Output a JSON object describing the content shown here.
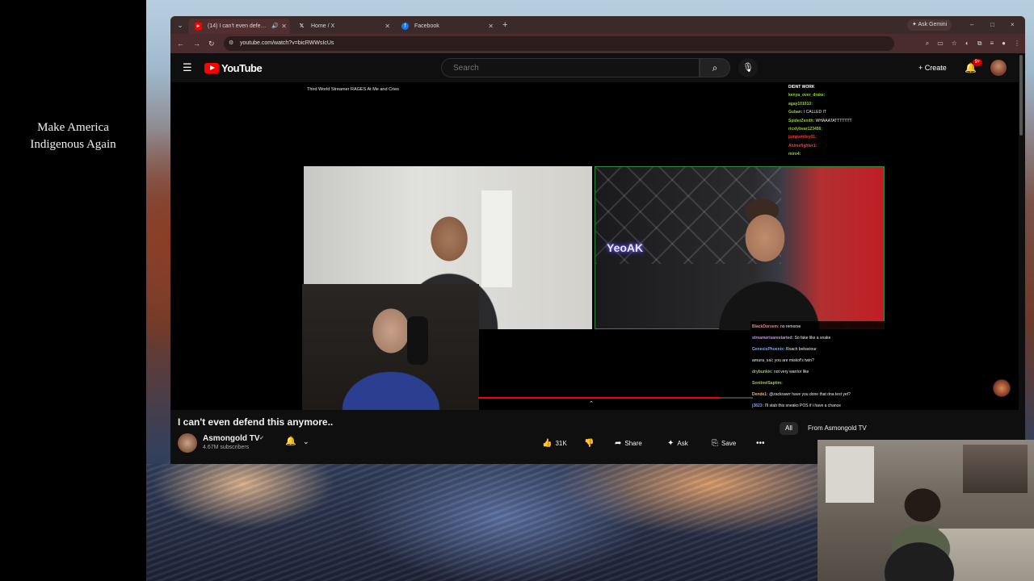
{
  "overlay": {
    "slogan_line1": "Make America",
    "slogan_line2": "Indigenous Again"
  },
  "browser": {
    "tabs": [
      {
        "label": "(14) I can't even defend thi",
        "active": true,
        "favicon": "youtube-icon"
      },
      {
        "label": "Home / X",
        "active": false,
        "favicon": "x-icon"
      },
      {
        "label": "Facebook",
        "active": false,
        "favicon": "facebook-icon"
      }
    ],
    "new_tab": "+",
    "ask_gemini": "Ask Gemini",
    "url": "youtube.com/watch?v=bicRWWsIcUs",
    "window_controls": [
      "–",
      "□",
      "×"
    ]
  },
  "youtube": {
    "logo_text": "YouTube",
    "search_placeholder": "Search",
    "create_label": "Create",
    "notification_count": "9+",
    "brand_color": "#ff0000"
  },
  "video": {
    "stream_title": "Third World Streamer RAGES At Me and Cries",
    "neon_sign": "YeoAK",
    "progress_fraction": 0.88,
    "chat_top": [
      {
        "user": "DIDNT WORK",
        "msg": "",
        "color": "#ffffff"
      },
      {
        "user": "kenya_over_drake:",
        "msg": "",
        "color": "#9acd32"
      },
      {
        "user": "agay101010:",
        "msg": "",
        "color": "#9acd32"
      },
      {
        "user": "Guban:",
        "msg": "I CALLED IT",
        "color": "#9acd32"
      },
      {
        "user": "SpiderZenith:",
        "msg": "WHAAATATTTTTTT",
        "color": "#9acd32"
      },
      {
        "user": "ricxlybear123456:",
        "msg": "",
        "color": "#9acd32"
      },
      {
        "user": "jumpsmiley01:",
        "msg": "",
        "color": "#ff3b3b"
      },
      {
        "user": "Animefighter1:",
        "msg": "",
        "color": "#ff3b3b"
      },
      {
        "user": "miro4:",
        "msg": "",
        "color": "#9acd32"
      }
    ],
    "chat_bottom": [
      {
        "user": "BlackDorsem:",
        "msg": "no remorse",
        "color": "#ff7a7a"
      },
      {
        "user": "streamerisarestarted:",
        "msg": "So fake like a snake",
        "color": "#d08cff"
      },
      {
        "user": "GenesisPhoenix:",
        "msg": "Roach behaviour",
        "color": "#6aa8ff"
      },
      {
        "user": "amura_ssi:",
        "msg": "you are miskof's twin?",
        "color": "#bbbbbb"
      },
      {
        "user": "drybunkie:",
        "msg": "not very warrior like",
        "color": "#9acd32"
      },
      {
        "user": "SentinelSaptim:",
        "msg": "",
        "color": "#9acd32"
      },
      {
        "user": "Dende1:",
        "msg": "@zackrawrr have you done that dna test yet?",
        "color": "#ffb347"
      },
      {
        "user": "j3823:",
        "msg": "I'll stab this sneako POS if i have a chance",
        "color": "#6aa8ff"
      }
    ]
  },
  "below_video": {
    "title": "I can't even defend this anymore..",
    "channel_name": "Asmongold TV",
    "subscribers": "4.67M subscribers",
    "likes": "31K",
    "share_label": "Share",
    "ask_label": "Ask",
    "save_label": "Save",
    "chips": [
      "All",
      "From Asmongold TV"
    ]
  }
}
